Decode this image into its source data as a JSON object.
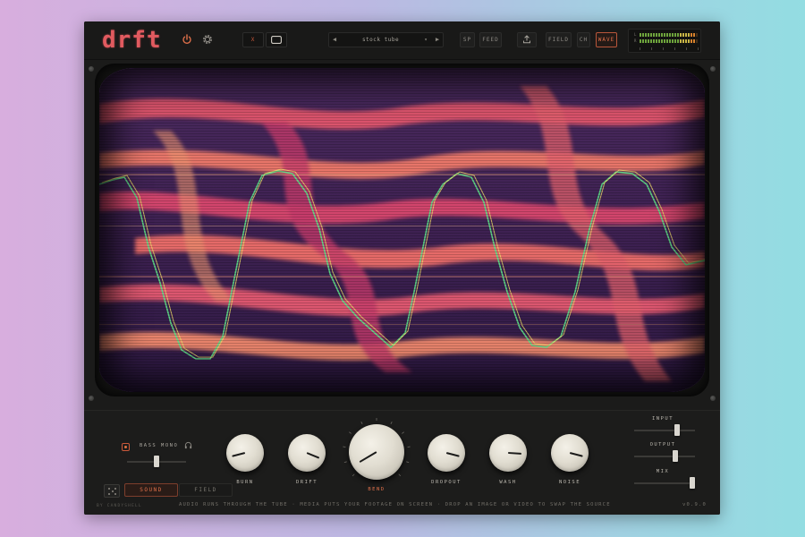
{
  "header": {
    "logo": "drft",
    "btn_x": "X",
    "preset_prev": "◀",
    "preset_name": "stock tube",
    "preset_dropdown": "▾",
    "preset_next": "▶",
    "btn_sp": "SP",
    "btn_feed": "FEED",
    "btn_field": "FIELD",
    "btn_ch": "CH",
    "btn_wave": "WAVE",
    "meter_l": "L",
    "meter_r": "R",
    "meter_level_l": 0.95,
    "meter_level_r": 0.95
  },
  "icons": {
    "power": "power-icon",
    "settings": "gear-icon",
    "display_toggle": "screen-icon",
    "upload": "upload-icon",
    "headphones": "headphones-icon",
    "randomize": "dice-icon"
  },
  "colors": {
    "accent": "#e0704a",
    "logo": "#e15a5f",
    "panel": "#1b1b1a",
    "knob": "#e6e2d6"
  },
  "bass_mono": {
    "label": "BASS MONO",
    "value": 0.5
  },
  "knobs": [
    {
      "label": "BURN",
      "value": 0.78
    },
    {
      "label": "DRIFT",
      "value": 0.25
    },
    {
      "label": "BEND",
      "value": 0.72
    },
    {
      "label": "DROPOUT",
      "value": 0.22
    },
    {
      "label": "WASH",
      "value": 0.18
    },
    {
      "label": "NOISE",
      "value": 0.22
    }
  ],
  "right_sliders": [
    {
      "label": "INPUT",
      "value": 0.75
    },
    {
      "label": "OUTPUT",
      "value": 0.72
    },
    {
      "label": "MIX",
      "value": 1.0
    }
  ],
  "tabs": {
    "sound": "SOUND",
    "field": "FIELD"
  },
  "footer": {
    "brand": "BY CANDYSHELL",
    "hint": "AUDIO RUNS THROUGH THE TUBE  ·  MEDIA PUTS YOUR FOOTAGE ON SCREEN  ·  DROP AN IMAGE OR VIDEO TO SWAP THE SOURCE",
    "version": "v0.9.0"
  }
}
